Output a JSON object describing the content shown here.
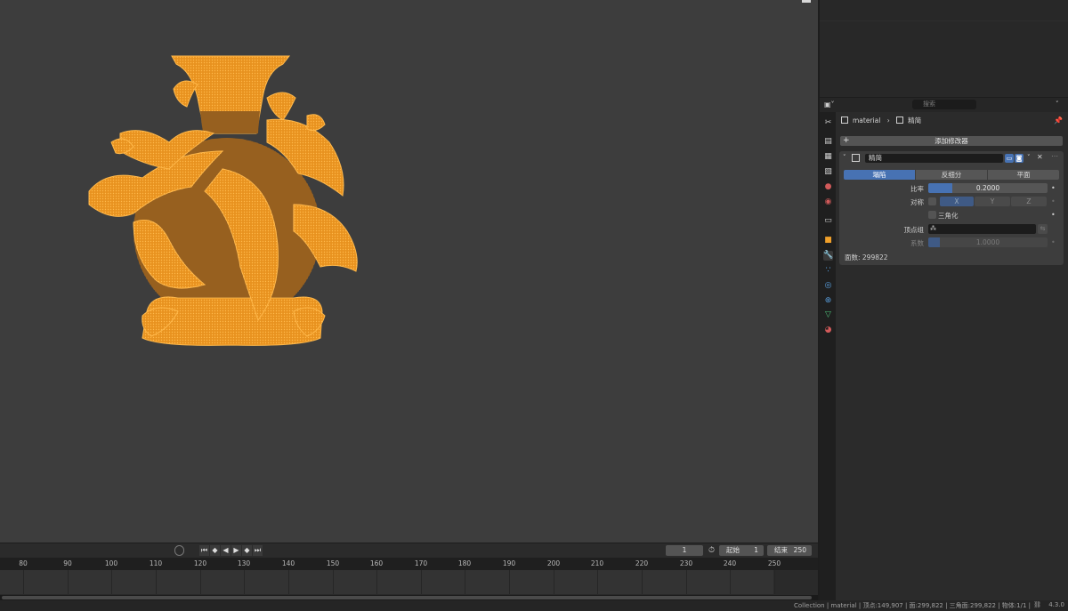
{
  "status_bar": {
    "info": "Collection | material | 顶点:149,907 | 面:299,822 | 三角面:299,822 | 物体:1/1 |",
    "version": "4.3.0"
  },
  "timeline": {
    "current_frame": "1",
    "start_label": "起始",
    "start_value": "1",
    "end_label": "结束",
    "end_value": "250",
    "ticks": [
      "80",
      "90",
      "100",
      "110",
      "120",
      "130",
      "140",
      "150",
      "160",
      "170",
      "180",
      "190",
      "200",
      "210",
      "220",
      "230",
      "240",
      "250"
    ]
  },
  "properties": {
    "search_placeholder": "搜索",
    "breadcrumb_object": "material",
    "breadcrumb_modifier": "精简",
    "add_modifier": "添加修改器",
    "modifier": {
      "name": "精简",
      "mode_tabs": [
        "塌陷",
        "反细分",
        "平面"
      ],
      "active_mode": 0,
      "ratio_label": "比率",
      "ratio_value": "0.2000",
      "ratio_fraction": 0.2,
      "symmetry_label": "对称",
      "axes": [
        "X",
        "Y",
        "Z"
      ],
      "triangulate_label": "三角化",
      "vertex_group_label": "顶点组",
      "factor_label": "系数",
      "factor_value": "1.0000",
      "face_count": "面数: 299822"
    }
  },
  "colors": {
    "selection_orange": "#f0a02a",
    "accent_blue": "#4772b3"
  }
}
